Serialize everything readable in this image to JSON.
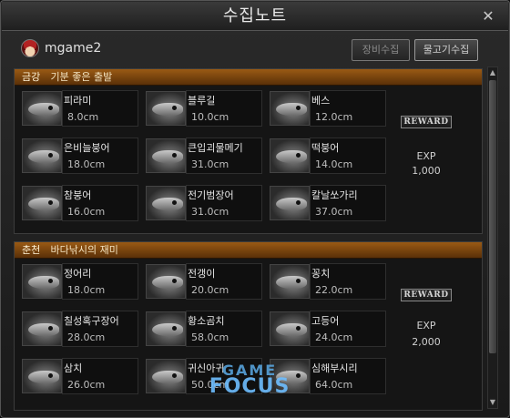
{
  "window": {
    "title": "수집노트",
    "close_glyph": "✕"
  },
  "user": {
    "name": "mgame2"
  },
  "buttons": {
    "equip": "장비수집",
    "collect": "물고기수집"
  },
  "sections": [
    {
      "region": "금강",
      "subtitle": "기분 좋은 출발",
      "fish": [
        {
          "name": "피라미",
          "size": "8.0cm"
        },
        {
          "name": "블루길",
          "size": "10.0cm"
        },
        {
          "name": "베스",
          "size": "12.0cm"
        },
        {
          "name": "은비늘붕어",
          "size": "18.0cm"
        },
        {
          "name": "큰입괴물메기",
          "size": "31.0cm"
        },
        {
          "name": "떡붕어",
          "size": "14.0cm"
        },
        {
          "name": "참붕어",
          "size": "16.0cm"
        },
        {
          "name": "전기범장어",
          "size": "31.0cm"
        },
        {
          "name": "칼날쏘가리",
          "size": "37.0cm"
        }
      ],
      "reward_label": "REWARD",
      "exp_label": "EXP",
      "exp_value": "1,000"
    },
    {
      "region": "춘천",
      "subtitle": "바다낚시의 재미",
      "fish": [
        {
          "name": "정어리",
          "size": "18.0cm"
        },
        {
          "name": "전갱이",
          "size": "20.0cm"
        },
        {
          "name": "꽁치",
          "size": "22.0cm"
        },
        {
          "name": "칠성혹구장어",
          "size": "28.0cm"
        },
        {
          "name": "황소곰치",
          "size": "58.0cm"
        },
        {
          "name": "고등어",
          "size": "24.0cm"
        },
        {
          "name": "삼치",
          "size": "26.0cm"
        },
        {
          "name": "귀신아귀",
          "size": "50.0cm"
        },
        {
          "name": "심해부시리",
          "size": "64.0cm"
        }
      ],
      "reward_label": "REWARD",
      "exp_label": "EXP",
      "exp_value": "2,000"
    }
  ],
  "scrollbar": {
    "up": "▲",
    "down": "▼"
  },
  "watermark": {
    "line1": "GAME",
    "line2": "FOCUS"
  }
}
